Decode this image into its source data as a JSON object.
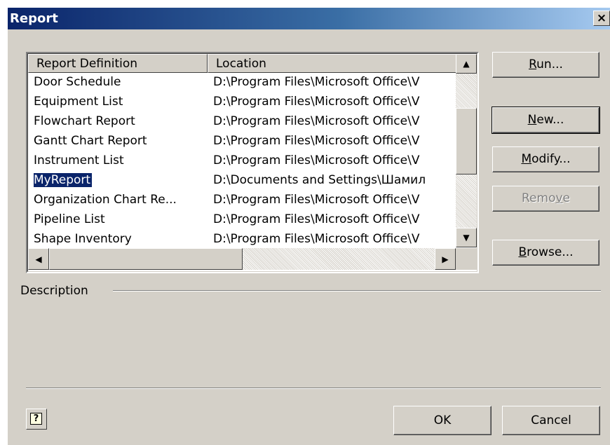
{
  "window": {
    "title": "Report",
    "close_label": "×"
  },
  "list": {
    "columns": [
      "Report Definition",
      "Location"
    ],
    "rows": [
      {
        "name": "Door Schedule",
        "location": "D:\\Program Files\\Microsoft Office\\V"
      },
      {
        "name": "Equipment List",
        "location": "D:\\Program Files\\Microsoft Office\\V"
      },
      {
        "name": "Flowchart Report",
        "location": "D:\\Program Files\\Microsoft Office\\V"
      },
      {
        "name": "Gantt Chart Report",
        "location": "D:\\Program Files\\Microsoft Office\\V"
      },
      {
        "name": "Instrument List",
        "location": "D:\\Program Files\\Microsoft Office\\V"
      },
      {
        "name": "MyReport",
        "location": "D:\\Documents and Settings\\Шамил"
      },
      {
        "name": "Organization Chart Re...",
        "location": "D:\\Program Files\\Microsoft Office\\V"
      },
      {
        "name": "Pipeline List",
        "location": "D:\\Program Files\\Microsoft Office\\V"
      },
      {
        "name": "Shape Inventory",
        "location": "D:\\Program Files\\Microsoft Office\\V"
      }
    ],
    "selected_index": 5
  },
  "buttons": {
    "run": {
      "mnemonic": "R",
      "rest": "un..."
    },
    "new": {
      "mnemonic": "N",
      "rest": "ew..."
    },
    "modify": {
      "mnemonic": "M",
      "rest": "odify..."
    },
    "remove": {
      "pre": "Remo",
      "mnemonic": "v",
      "rest": "e"
    },
    "browse": {
      "mnemonic": "B",
      "rest": "rowse..."
    },
    "ok": "OK",
    "cancel": "Cancel"
  },
  "description": {
    "label": "Description",
    "text": ""
  },
  "help_icon": "?",
  "icons": {
    "scroll_up": "▲",
    "scroll_down": "▼",
    "scroll_left": "◀",
    "scroll_right": "▶",
    "help": "help-icon",
    "close": "close-icon"
  }
}
